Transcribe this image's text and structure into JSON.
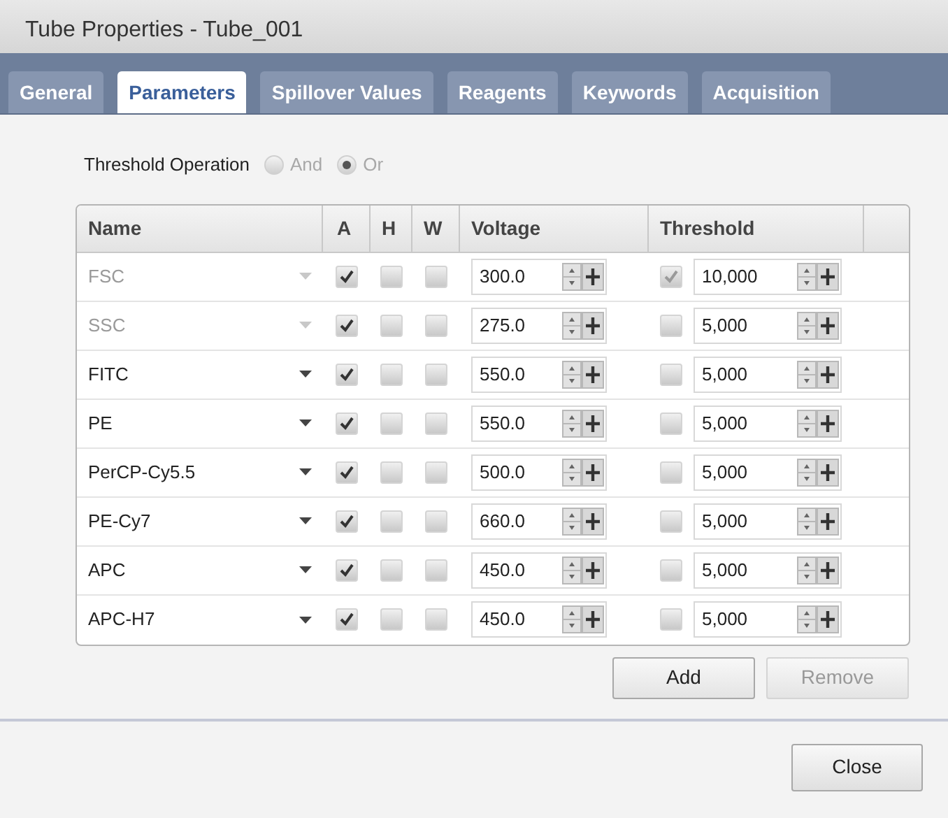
{
  "window": {
    "title": "Tube Properties - Tube_001"
  },
  "tabs": [
    {
      "label": "General",
      "selected": false
    },
    {
      "label": "Parameters",
      "selected": true
    },
    {
      "label": "Spillover Values",
      "selected": false
    },
    {
      "label": "Reagents",
      "selected": false
    },
    {
      "label": "Keywords",
      "selected": false
    },
    {
      "label": "Acquisition",
      "selected": false
    }
  ],
  "threshold_operation": {
    "label": "Threshold Operation",
    "options": [
      {
        "label": "And",
        "selected": false,
        "disabled": true
      },
      {
        "label": "Or",
        "selected": true,
        "disabled": true
      }
    ]
  },
  "table": {
    "columns": [
      "Name",
      "A",
      "H",
      "W",
      "Voltage",
      "Threshold"
    ],
    "rows": [
      {
        "name": "FSC",
        "disabled": true,
        "a": true,
        "h": false,
        "w": false,
        "voltage": "300.0",
        "threshold_checked": true,
        "threshold": "10,000"
      },
      {
        "name": "SSC",
        "disabled": true,
        "a": true,
        "h": false,
        "w": false,
        "voltage": "275.0",
        "threshold_checked": false,
        "threshold": "5,000"
      },
      {
        "name": "FITC",
        "disabled": false,
        "a": true,
        "h": false,
        "w": false,
        "voltage": "550.0",
        "threshold_checked": false,
        "threshold": "5,000"
      },
      {
        "name": "PE",
        "disabled": false,
        "a": true,
        "h": false,
        "w": false,
        "voltage": "550.0",
        "threshold_checked": false,
        "threshold": "5,000"
      },
      {
        "name": "PerCP-Cy5.5",
        "disabled": false,
        "a": true,
        "h": false,
        "w": false,
        "voltage": "500.0",
        "threshold_checked": false,
        "threshold": "5,000"
      },
      {
        "name": "PE-Cy7",
        "disabled": false,
        "a": true,
        "h": false,
        "w": false,
        "voltage": "660.0",
        "threshold_checked": false,
        "threshold": "5,000"
      },
      {
        "name": "APC",
        "disabled": false,
        "a": true,
        "h": false,
        "w": false,
        "voltage": "450.0",
        "threshold_checked": false,
        "threshold": "5,000"
      },
      {
        "name": "APC-H7",
        "disabled": false,
        "a": true,
        "h": false,
        "w": false,
        "voltage": "450.0",
        "threshold_checked": false,
        "threshold": "5,000"
      }
    ]
  },
  "table_buttons": [
    {
      "label": "Add",
      "disabled": false
    },
    {
      "label": "Remove",
      "disabled": true
    }
  ],
  "footer_buttons": [
    {
      "label": "Close"
    }
  ]
}
